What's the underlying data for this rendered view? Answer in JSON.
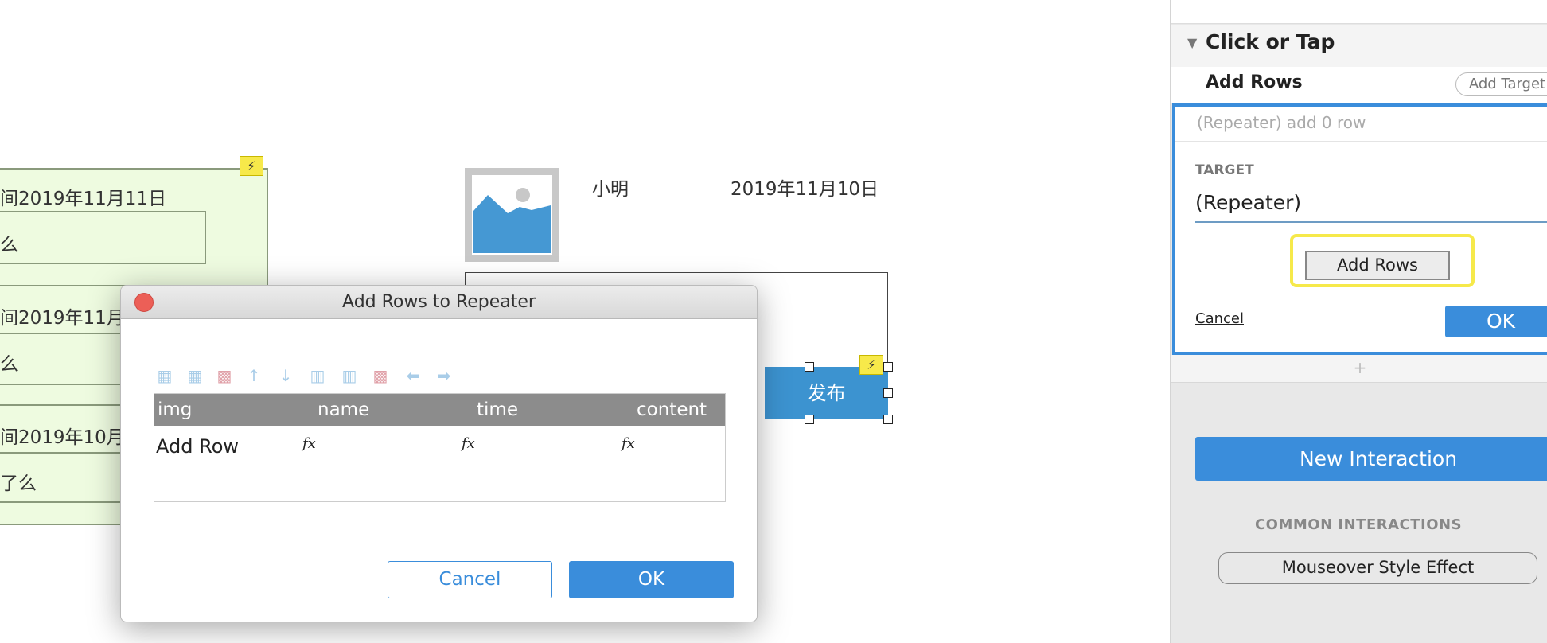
{
  "canvas": {
    "repeater_rows": [
      {
        "time": "间2019年11月11日",
        "content": "么"
      },
      {
        "time": "间2019年11月",
        "content": "么"
      },
      {
        "time": "间2019年10月",
        "content": "了么"
      }
    ],
    "name": "小明",
    "date": "2019年11月10日",
    "publish_button": "发布",
    "interaction_badge_icon": "lightning-icon",
    "image_placeholder_icon": "image-icon"
  },
  "dialog": {
    "title": "Add Rows to Repeater",
    "toolbar_icons": [
      "insert-row-above-icon",
      "insert-row-below-icon",
      "delete-row-icon",
      "move-up-icon",
      "move-down-icon",
      "insert-column-left-icon",
      "insert-column-right-icon",
      "delete-column-icon",
      "move-left-icon",
      "move-right-icon"
    ],
    "table": {
      "columns": [
        "img",
        "name",
        "time",
        "content"
      ],
      "rows": [
        [
          "Add Row",
          "fx",
          "fx",
          "fx"
        ]
      ]
    },
    "cancel": "Cancel",
    "ok": "OK"
  },
  "panel": {
    "event": "Click or Tap",
    "action": "Add Rows",
    "add_target": "Add Target",
    "summary": "(Repeater) add 0 row",
    "target_label": "TARGET",
    "target_value": "(Repeater)",
    "add_rows_button": "Add Rows",
    "cancel": "Cancel",
    "ok": "OK",
    "plus": "+",
    "new_interaction": "New Interaction",
    "common_label": "COMMON INTERACTIONS",
    "common_items": [
      "Mouseover Style Effect"
    ],
    "accent": "#3a8ddb",
    "highlight": "#f6e94a"
  }
}
